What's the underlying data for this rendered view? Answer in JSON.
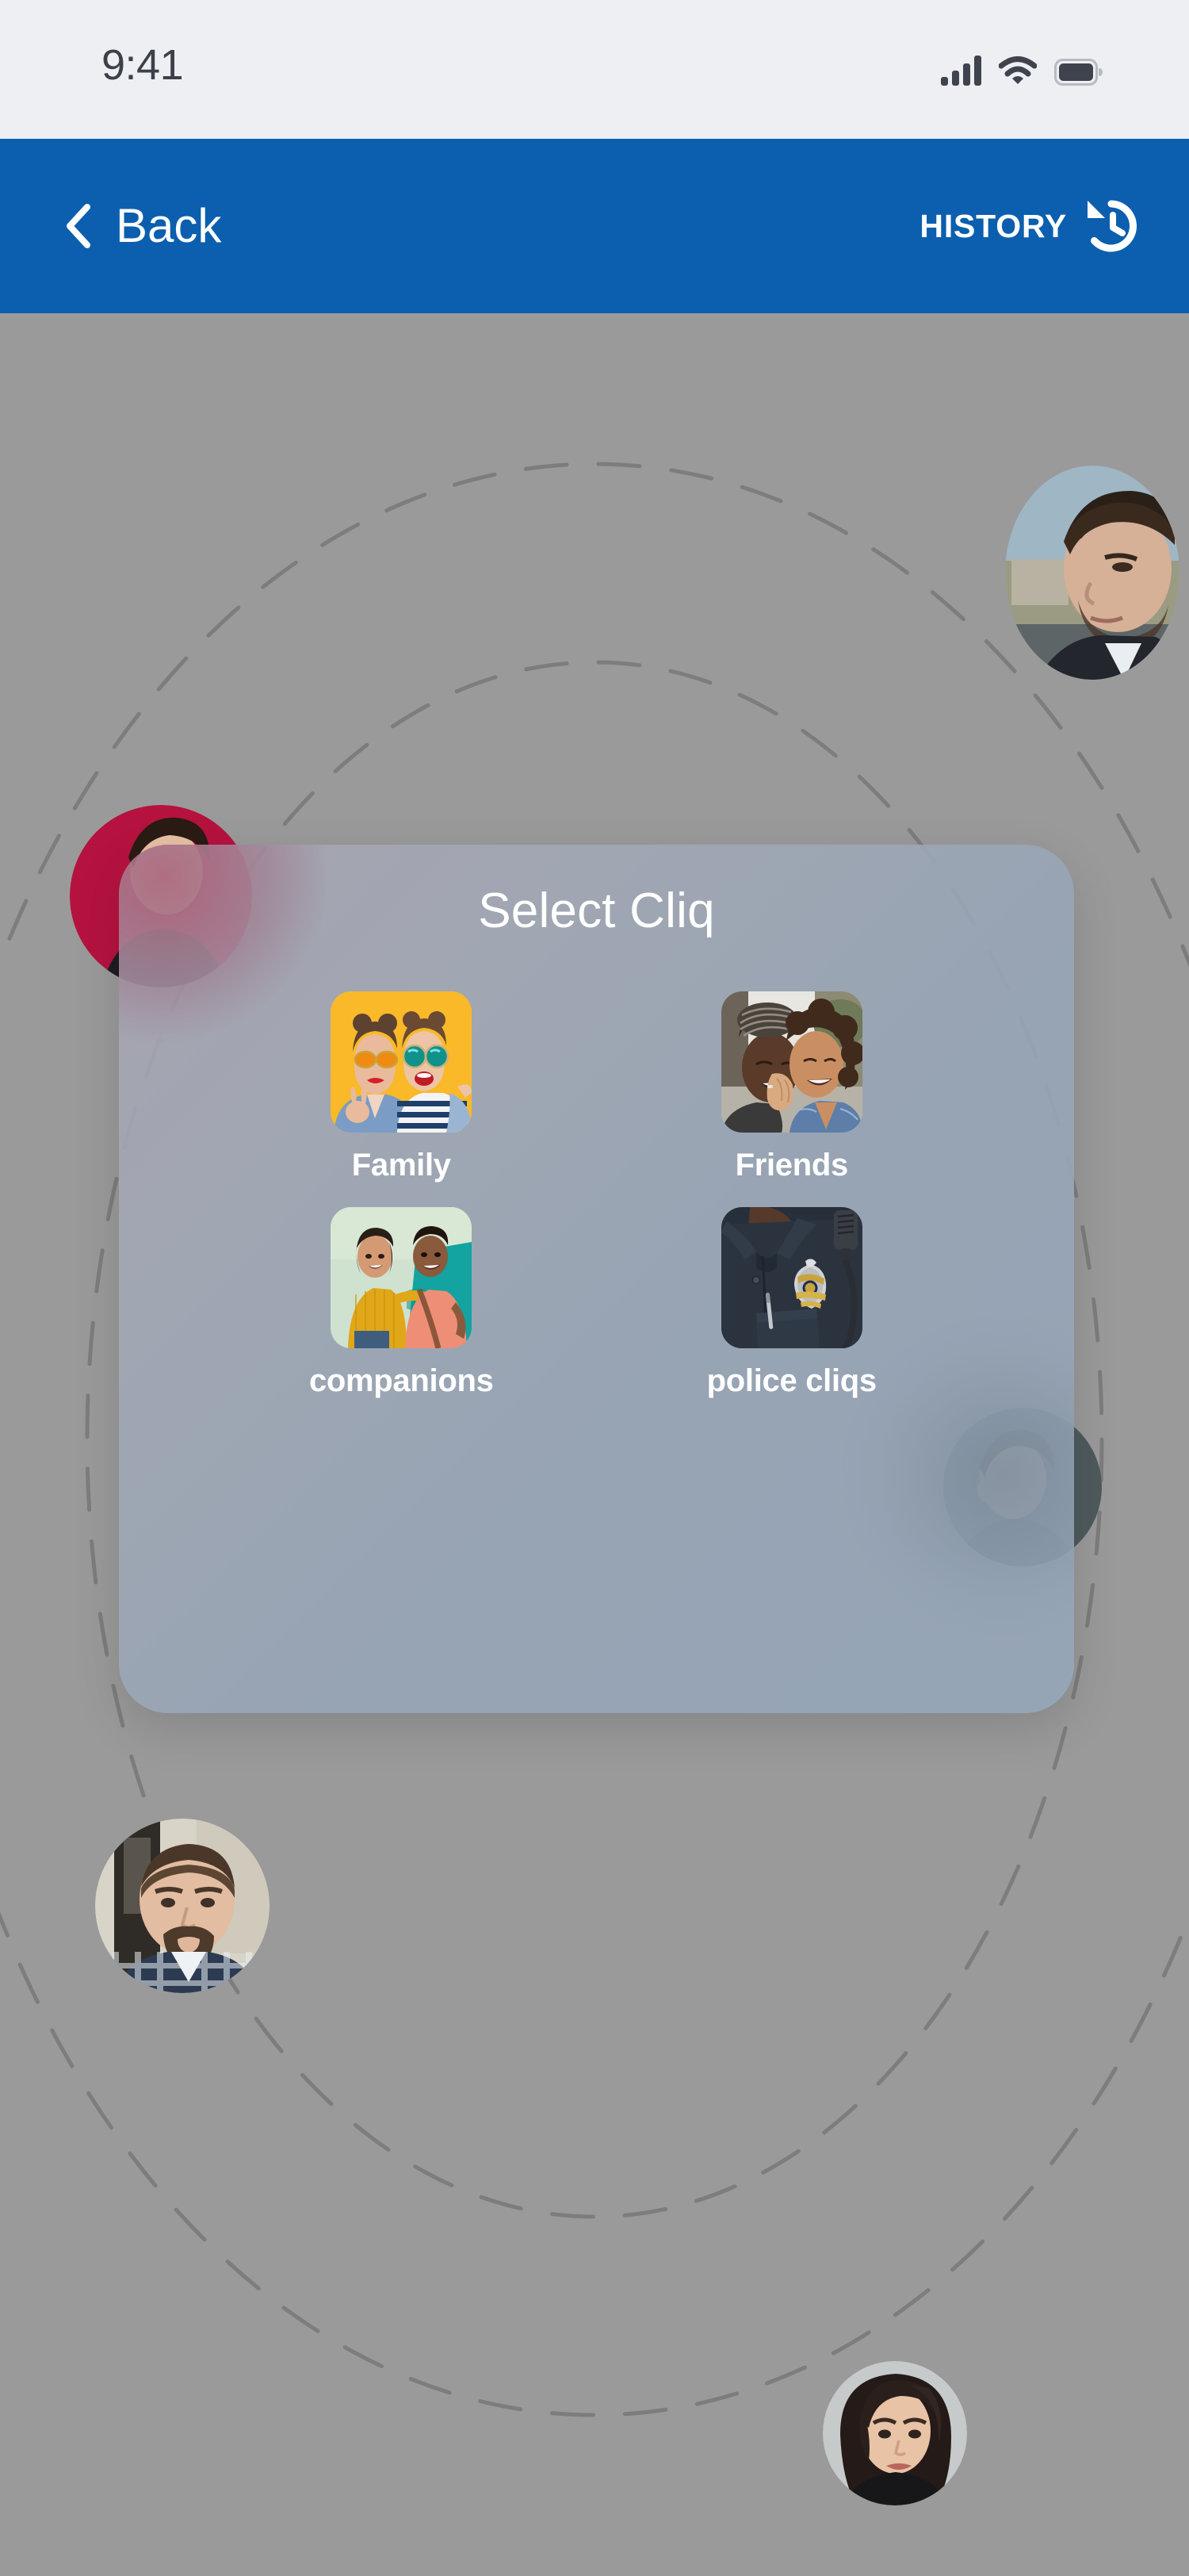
{
  "status_bar": {
    "time": "9:41",
    "signal_icon": "signal-bars-icon",
    "wifi_icon": "wifi-icon",
    "battery_icon": "battery-full-icon",
    "background_color": "#edeff3",
    "icon_color": "#3e434d"
  },
  "nav_bar": {
    "background_color": "#0b5fae",
    "back_label": "Back",
    "back_icon": "chevron-left-icon",
    "history_label": "HISTORY",
    "history_icon": "history-clock-icon",
    "text_color": "#ffffff"
  },
  "modal": {
    "title": "Select Cliq",
    "panel_color": "#96a6b8",
    "title_color": "#ffffff",
    "cliqs": [
      {
        "label": "Family",
        "thumb": "two-women-yellow-background-selfie",
        "accent": "#f9b928"
      },
      {
        "label": "Friends",
        "thumb": "two-women-embracing-outdoors",
        "accent": "#b9c4cc"
      },
      {
        "label": "companions",
        "thumb": "couple-against-teal-mint-wall",
        "accent": "#2aa6a0"
      },
      {
        "label": "police cliqs",
        "thumb": "police-officer-badge-uniform",
        "accent": "#2a3340"
      }
    ]
  },
  "backdrop": {
    "background_color": "#9a9a9a",
    "orbit_color": "#7d7d7d",
    "orbit_style": "dashed-ellipse",
    "orbit_count": 2,
    "avatars": [
      {
        "name": "avatar-man-dark-hair-top-right",
        "position": "top-right-edge"
      },
      {
        "name": "avatar-red-background-hidden",
        "position": "behind-modal-top-left"
      },
      {
        "name": "avatar-person-dark-hidden",
        "position": "behind-modal-right"
      },
      {
        "name": "avatar-bearded-man-plaid-shirt",
        "position": "lower-left"
      },
      {
        "name": "avatar-woman-dark-hair",
        "position": "bottom-right"
      }
    ]
  }
}
